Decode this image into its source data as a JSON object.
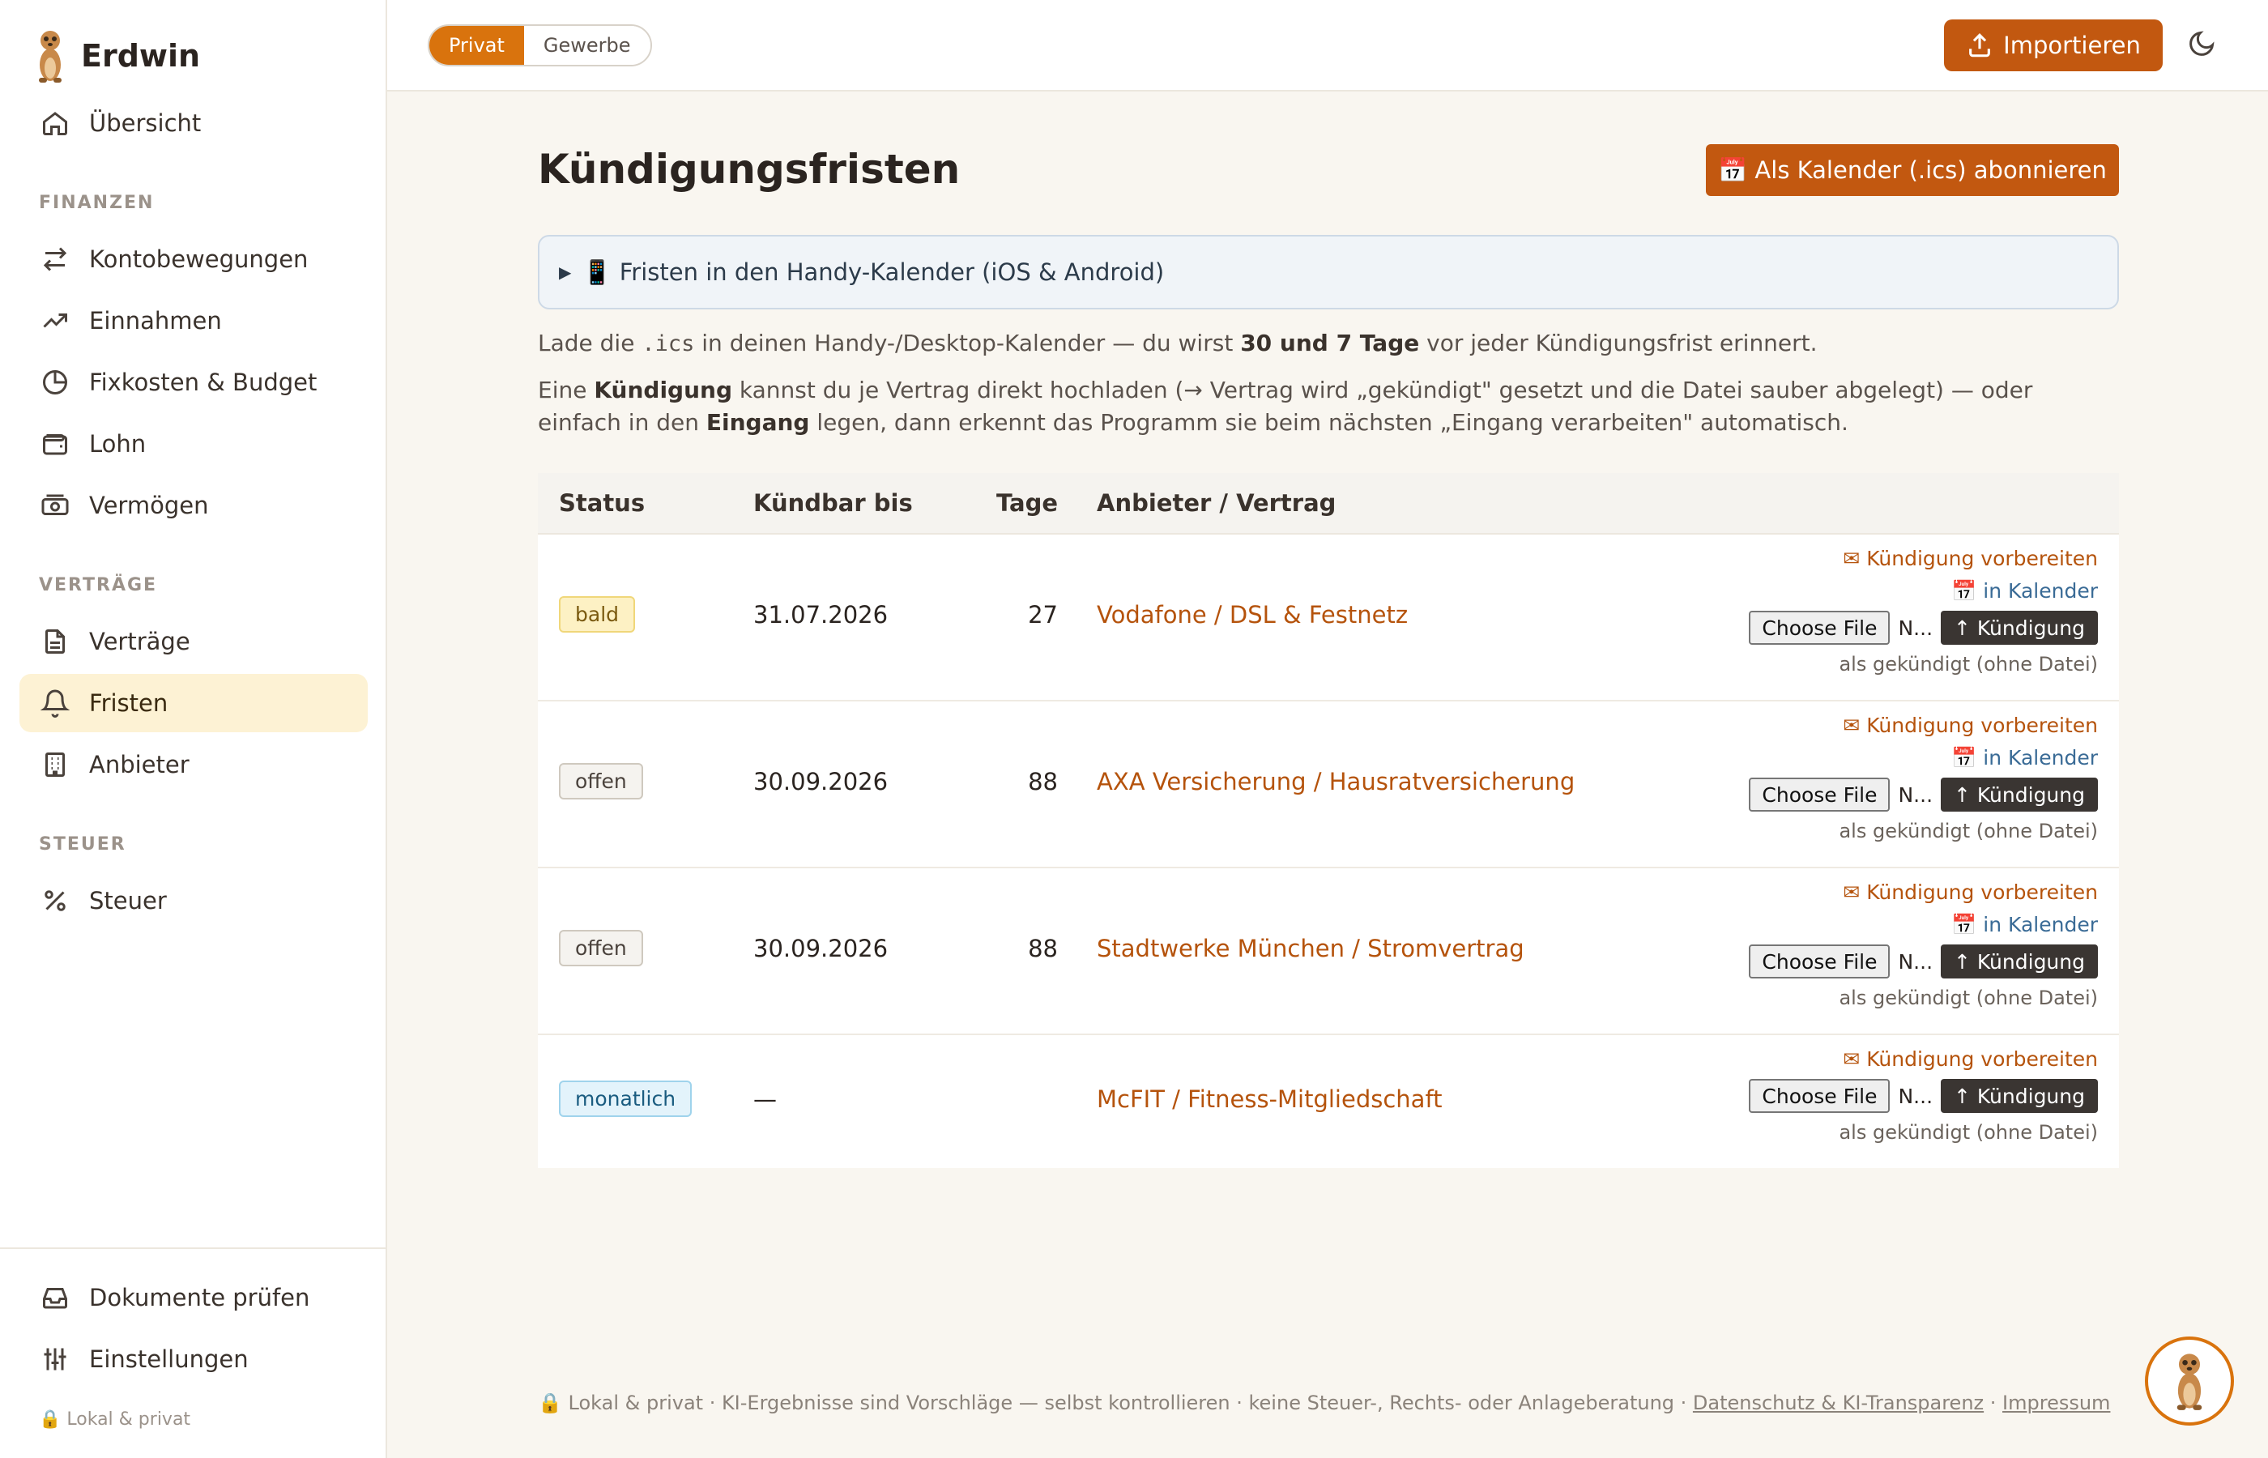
{
  "app": {
    "name": "Erdwin"
  },
  "sidebar": {
    "overview": "Übersicht",
    "section_finance": "FINANZEN",
    "finance_items": [
      "Kontobewegungen",
      "Einnahmen",
      "Fixkosten & Budget",
      "Lohn",
      "Vermögen"
    ],
    "section_contracts": "VERTRÄGE",
    "contract_items": [
      "Verträge",
      "Fristen",
      "Anbieter"
    ],
    "active_item": "Fristen",
    "section_tax": "STEUER",
    "tax_items": [
      "Steuer"
    ],
    "bottom_items": [
      "Dokumente prüfen",
      "Einstellungen"
    ],
    "privacy_note": "🔒 Lokal & privat"
  },
  "topbar": {
    "mode_private": "Privat",
    "mode_business": "Gewerbe",
    "active_mode": "Privat",
    "import_label": "Importieren"
  },
  "page": {
    "title": "Kündigungsfristen",
    "ics_button": "📅 Als Kalender (.ics) abonnieren",
    "details_summary": "📱 Fristen in den Handy-Kalender (iOS & Android)",
    "para1_a": "Lade die ",
    "para1_code": ".ics",
    "para1_b": " in deinen Handy-/Desktop-Kalender — du wirst ",
    "para1_bold": "30 und 7 Tage",
    "para1_c": " vor jeder Kündigungsfrist erinnert.",
    "para2_a": "Eine ",
    "para2_bold1": "Kündigung",
    "para2_b": " kannst du je Vertrag direkt hochladen (→ Vertrag wird „gekündigt\" gesetzt und die Datei sauber abgelegt) — oder einfach in den ",
    "para2_bold2": "Eingang",
    "para2_c": " legen, dann erkennt das Programm sie beim nächsten „Eingang verarbeiten\" automatisch."
  },
  "table": {
    "headers": {
      "status": "Status",
      "date": "Kündbar bis",
      "days": "Tage",
      "vendor": "Anbieter / Vertrag"
    },
    "rows": [
      {
        "status": "bald",
        "date": "31.07.2026",
        "days": "27",
        "vendor": "Vodafone / DSL & Festnetz"
      },
      {
        "status": "offen",
        "date": "30.09.2026",
        "days": "88",
        "vendor": "AXA Versicherung / Hausratversicherung"
      },
      {
        "status": "offen",
        "date": "30.09.2026",
        "days": "88",
        "vendor": "Stadtwerke München / Stromvertrag"
      },
      {
        "status": "monatlich",
        "date": "—",
        "days": "",
        "vendor": "McFIT / Fitness-Mitgliedschaft"
      }
    ],
    "action_prepare": "✉ Kündigung vorbereiten",
    "action_calendar": "📅 in Kalender",
    "choose_file": "Choose File",
    "file_name": "N...",
    "upload_label": "↑ Kündigung",
    "mark_done": "als gekündigt (ohne Datei)"
  },
  "footer": {
    "text": "🔒 Lokal & privat · KI-Ergebnisse sind Vorschläge — selbst kontrollieren · keine Steuer-, Rechts- oder Anlageberatung · ",
    "link_privacy": "Datenschutz & KI-Transparenz",
    "sep": " · ",
    "link_imprint": "Impressum"
  },
  "colors": {
    "accent": "#c25810",
    "accent_toggle": "#d9730d",
    "link": "#b5530c",
    "active_nav": "#fdf2d4"
  }
}
